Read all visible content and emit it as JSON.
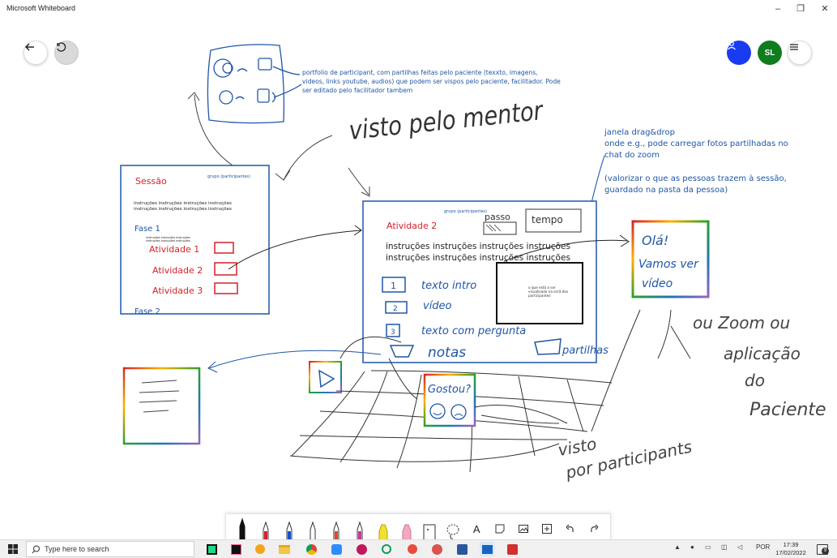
{
  "window": {
    "title": "Microsoft Whiteboard",
    "controls": {
      "minimize": "–",
      "maximize": "❐",
      "close": "✕"
    }
  },
  "header": {
    "back_icon": "arrow-left-icon",
    "history_icon": "history-icon",
    "invite_icon": "person-icon",
    "user_initials": "SL",
    "menu_icon": "hamburger-icon",
    "colors": {
      "invite": "#1a3cf0",
      "user": "#0f7c1e"
    }
  },
  "board": {
    "heading_note": "visto pelo mentor",
    "portfolio_note": [
      "portfolio de participant, com partilhas feitas pelo paciente (texxto, imagens,",
      "videos, links youtube, audios) que podem ser vispos pelo paciente, facilitador. Pode",
      "ser editado pelo facilitador tambem"
    ],
    "dragdrop_note": [
      "janela drag&drop",
      "onde e.g., pode carregar fotos partilhadas no",
      "chat do zoom",
      "",
      "(valorizar o que as pessoas trazem à sessão,",
      "guardado na pasta da pessoa)"
    ],
    "session_card": {
      "title": "Sessão",
      "group_label": "grupo (participantes)",
      "instructions": [
        "instruções instruções instruções instruções",
        "instruções instruções instruções instruções"
      ],
      "phase1": "Fase 1",
      "phase1_small": [
        "instruções instruções instruções",
        "instruções instruções instruções"
      ],
      "activities": [
        "Atividade 1",
        "Atividade 2",
        "Atividade 3"
      ],
      "phase2": "Fase 2"
    },
    "activity_card": {
      "group_label": "grupo (participantes)",
      "title": "Atividade 2",
      "instructions": [
        "instruções instruções instruções instruções",
        "instruções instruções instruções instruções"
      ],
      "steps": [
        {
          "num": "1",
          "label": "texto intro"
        },
        {
          "num": "2",
          "label": "vídeo"
        },
        {
          "num": "3",
          "label": "texto com pergunta"
        }
      ],
      "notes_label": "notas",
      "share_label": "partilhas",
      "passo_label": "passo",
      "tempo_label": "tempo",
      "video_box_text": [
        "o que está a ser",
        "visualizado na ecrã dos",
        "participantes"
      ]
    },
    "hello_card": {
      "line1": "Olá!",
      "line2": "Vamos ver",
      "line3": "vídeo"
    },
    "feedback_card": {
      "title": "Gostou?"
    },
    "zoom_note": [
      "ou Zoom ou",
      "aplicação",
      "do",
      "Paciente"
    ],
    "seen_note": [
      "visto",
      "por participants"
    ]
  },
  "toolbar": {
    "tools": [
      {
        "name": "black-pen",
        "color": "#111111"
      },
      {
        "name": "red-pen",
        "color": "#d6202a"
      },
      {
        "name": "blue-pen",
        "color": "#1a4fc8"
      },
      {
        "name": "white-pen",
        "color": "#ffffff"
      },
      {
        "name": "rainbow-pen",
        "color": "#e04a2b"
      },
      {
        "name": "galaxy-pen",
        "color": "#c43c9a"
      },
      {
        "name": "yellow-highlighter",
        "color": "#f2e030"
      },
      {
        "name": "pink-highlighter",
        "color": "#f4a7c0"
      }
    ],
    "eraser_icon": "eraser-icon",
    "lasso_icon": "lasso-icon",
    "text_icon": "text-icon",
    "text_glyph": "A",
    "note_icon": "note-icon",
    "image_icon": "image-icon",
    "insert_icon": "insert-icon",
    "undo_icon": "undo-icon",
    "redo_icon": "redo-icon"
  },
  "taskbar": {
    "search_placeholder": "Type here to search",
    "apps": [
      "pycharm",
      "intellij",
      "paint",
      "explorer",
      "chrome",
      "zoom",
      "teams",
      "maps",
      "git",
      "outlook",
      "powerpoint",
      "word",
      "whiteboard",
      "acrobat"
    ],
    "language": "POR",
    "time": "17:39",
    "date": "17/02/2022",
    "notification_count": "9"
  }
}
